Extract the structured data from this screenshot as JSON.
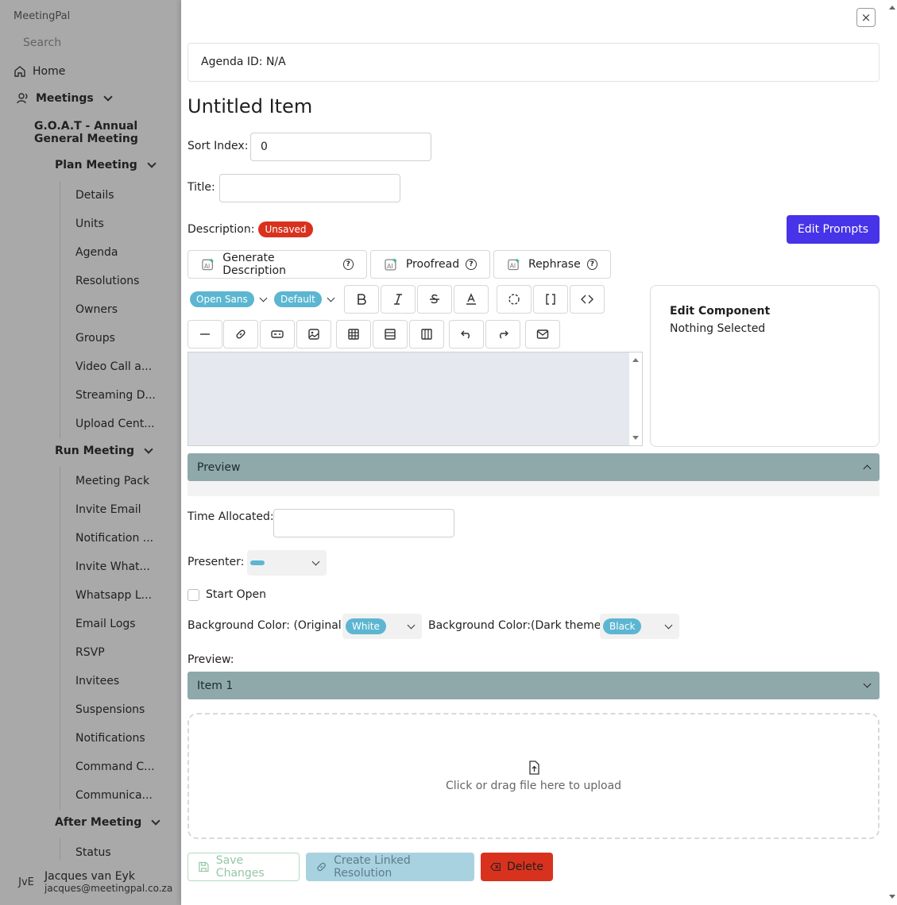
{
  "sidebar": {
    "app_name": "MeetingPal",
    "search_placeholder": "Search",
    "home": "Home",
    "meetings": "Meetings",
    "meeting_name": "G.O.A.T - Annual General Meeting",
    "plan_meeting": "Plan Meeting",
    "plan_items": [
      "Details",
      "Units",
      "Agenda",
      "Resolutions",
      "Owners",
      "Groups",
      "Video Call a...",
      "Streaming D...",
      "Upload Cent..."
    ],
    "run_meeting": "Run Meeting",
    "run_items": [
      "Meeting Pack",
      "Invite Email",
      "Notification ...",
      "Invite What...",
      "Whatsapp L...",
      "Email Logs",
      "RSVP",
      "Invitees",
      "Suspensions",
      "Notifications",
      "Command C...",
      "Communica..."
    ],
    "after_meeting": "After Meeting",
    "after_items": [
      "Status"
    ],
    "user": {
      "initials": "JvE",
      "name": "Jacques van Eyk",
      "email": "jacques@meetingpal.co.za"
    }
  },
  "drawer": {
    "close_label": "×",
    "agenda_id": "Agenda ID: N/A",
    "title": "Untitled Item",
    "sort_index_label": "Sort Index:",
    "sort_index_value": "0",
    "title_label": "Title:",
    "title_value": "",
    "description_label": "Description:",
    "unsaved_badge": "Unsaved",
    "edit_prompts": "Edit Prompts",
    "ai_buttons": [
      "Generate Description",
      "Proofread",
      "Rephrase"
    ],
    "font_family": "Open Sans",
    "font_size": "Default",
    "edit_component_title": "Edit Component",
    "edit_component_value": "Nothing Selected",
    "preview_label": "Preview",
    "time_allocated_label": "Time Allocated:",
    "time_allocated_value": "",
    "presenter_label": "Presenter:",
    "start_open_label": "Start Open",
    "bg_original_label": "Background Color: (Original)",
    "bg_original_value": "White",
    "bg_dark_label": "Background Color:(Dark theme)",
    "bg_dark_value": "Black",
    "preview2_label": "Preview:",
    "item_accordion": "Item 1",
    "upload_text": "Click or drag file here to upload",
    "save_changes": "Save Changes",
    "create_linked": "Create Linked Resolution",
    "delete": "Delete"
  },
  "colors": {
    "accent_purple": "#4733e8",
    "danger_red": "#d8321e",
    "pill_blue": "#5cb6d1",
    "accordion_teal": "#8fa9ab"
  }
}
